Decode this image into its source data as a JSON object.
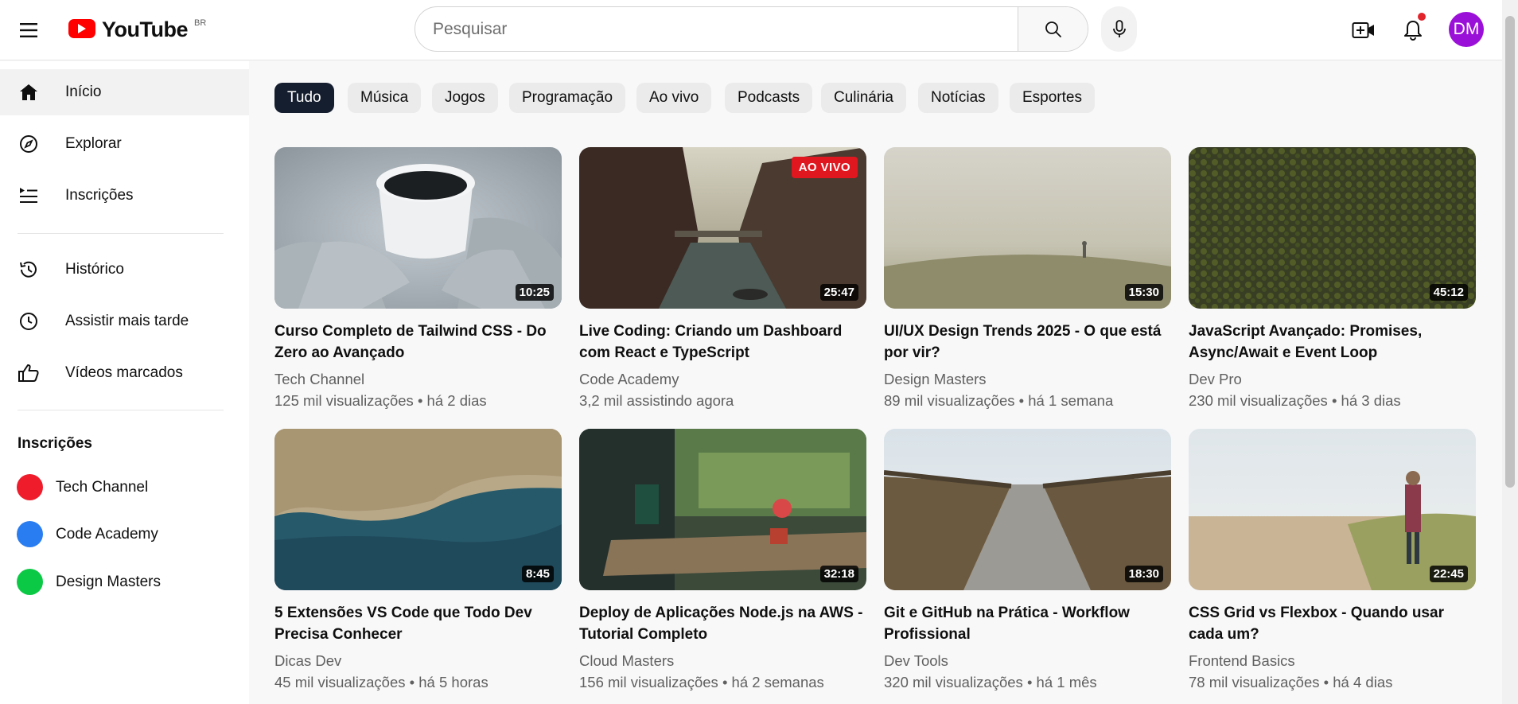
{
  "header": {
    "logo_text": "YouTube",
    "country": "BR",
    "search_placeholder": "Pesquisar",
    "avatar_initials": "DM",
    "avatar_color": "#9b10d8",
    "has_notification": true
  },
  "sidebar": {
    "items": [
      {
        "label": "Início",
        "icon": "home-icon",
        "active": true
      },
      {
        "label": "Explorar",
        "icon": "compass-icon"
      },
      {
        "label": "Inscrições",
        "icon": "subscriptions-icon"
      },
      {
        "label": "Histórico",
        "icon": "history-icon"
      },
      {
        "label": "Assistir mais tarde",
        "icon": "clock-icon"
      },
      {
        "label": "Vídeos marcados",
        "icon": "thumbs-up-icon"
      }
    ],
    "subscriptions_heading": "Inscrições",
    "subscriptions": [
      {
        "name": "Tech Channel",
        "color": "#ef1c2c"
      },
      {
        "name": "Code Academy",
        "color": "#2a7df0"
      },
      {
        "name": "Design Masters",
        "color": "#0cc945"
      }
    ]
  },
  "chips": [
    "Tudo",
    "Música",
    "Jogos",
    "Programação",
    "Ao vivo",
    "Podcasts",
    "Culinária",
    "Notícias",
    "Esportes"
  ],
  "videos": [
    {
      "title": "Curso Completo de Tailwind CSS - Do Zero ao Avançado",
      "channel": "Tech Channel",
      "meta": "125 mil visualizações • há 2 dias",
      "duration": "10:25",
      "thumb": "coffee-cup"
    },
    {
      "title": "Live Coding: Criando um Dashboard com React e TypeScript",
      "channel": "Code Academy",
      "meta": "3,2 mil assistindo agora",
      "duration": "25:47",
      "live_label": "AO VIVO",
      "thumb": "canal-city"
    },
    {
      "title": "UI/UX Design Trends 2025 - O que está por vir?",
      "channel": "Design Masters",
      "meta": "89 mil visualizações • há 1 semana",
      "duration": "15:30",
      "thumb": "foggy-field"
    },
    {
      "title": "JavaScript Avançado: Promises, Async/Await e Event Loop",
      "channel": "Dev Pro",
      "meta": "230 mil visualizações • há 3 dias",
      "duration": "45:12",
      "thumb": "forest-aerial"
    },
    {
      "title": "5 Extensões VS Code que Todo Dev Precisa Conhecer",
      "channel": "Dicas Dev",
      "meta": "45 mil visualizações • há 5 horas",
      "duration": "8:45",
      "thumb": "coastline"
    },
    {
      "title": "Deploy de Aplicações Node.js na AWS - Tutorial Completo",
      "channel": "Cloud Masters",
      "meta": "156 mil visualizações • há 2 semanas",
      "duration": "32:18",
      "thumb": "cafe-patio"
    },
    {
      "title": "Git e GitHub na Prática - Workflow Profissional",
      "channel": "Dev Tools",
      "meta": "320 mil visualizações • há 1 mês",
      "duration": "18:30",
      "thumb": "boardwalk"
    },
    {
      "title": "CSS Grid vs Flexbox - Quando usar cada um?",
      "channel": "Frontend Basics",
      "meta": "78 mil visualizações • há 4 dias",
      "duration": "22:45",
      "thumb": "beach-walk"
    }
  ]
}
